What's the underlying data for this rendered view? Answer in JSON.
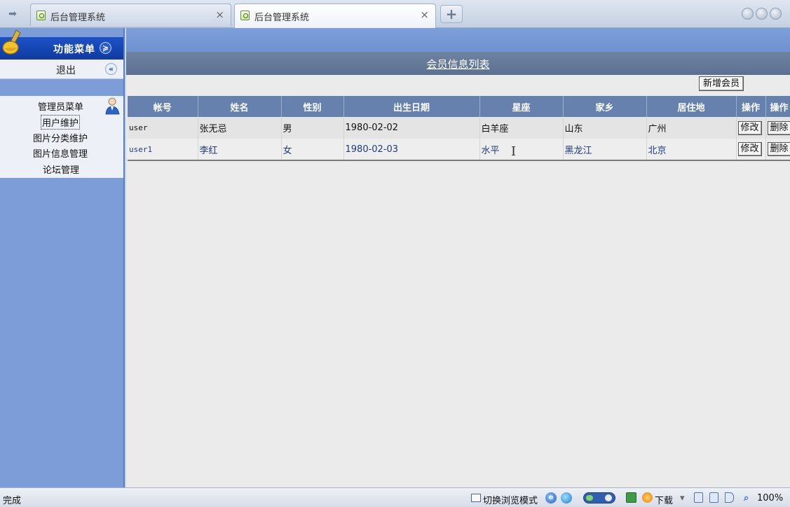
{
  "browser": {
    "tabs": [
      {
        "title": "后台管理系统",
        "active": false
      },
      {
        "title": "后台管理系统",
        "active": true
      }
    ],
    "close_glyph": "×",
    "newtab_glyph": "+",
    "back_glyph": "➡"
  },
  "sidebar": {
    "menu_header": "功能菜单",
    "menu_toggle_glyph": "≽",
    "logout_label": "退出",
    "collapse_glyph": "«",
    "submenu_title": "管理员菜单",
    "items": [
      {
        "label": "用户维护",
        "focused": true
      },
      {
        "label": "图片分类维护",
        "focused": false
      },
      {
        "label": "图片信息管理",
        "focused": false
      },
      {
        "label": "论坛管理",
        "focused": false
      }
    ]
  },
  "main": {
    "page_title": "会员信息列表",
    "add_button": "新增会员",
    "table": {
      "columns": [
        "帐号",
        "姓名",
        "性别",
        "出生日期",
        "星座",
        "家乡",
        "居住地",
        "操作",
        "操作"
      ],
      "rows": [
        {
          "account": "user",
          "name": "张无忌",
          "gender": "男",
          "birthday": "1980-02-02",
          "zodiac": "白羊座",
          "hometown": "山东",
          "residence": "广州",
          "edit": "修改",
          "delete": "删除"
        },
        {
          "account": "user1",
          "name": "李红",
          "gender": "女",
          "birthday": "1980-02-03",
          "zodiac": "水平",
          "hometown": "黑龙江",
          "residence": "北京",
          "edit": "修改",
          "delete": "删除"
        }
      ]
    },
    "cursor_glyph": "I"
  },
  "statusbar": {
    "status": "完成",
    "browse_mode": "切换浏览模式",
    "download": "下载",
    "zoom": "100%",
    "dropdown_glyph": "▾"
  },
  "colors": {
    "sidebar_bg": "#7c9dd8",
    "menu_header_bg": "#1d52c7",
    "table_header_bg": "#6681ae",
    "title_bar_bg": "#5c7091",
    "content_bg": "#ebebeb"
  }
}
